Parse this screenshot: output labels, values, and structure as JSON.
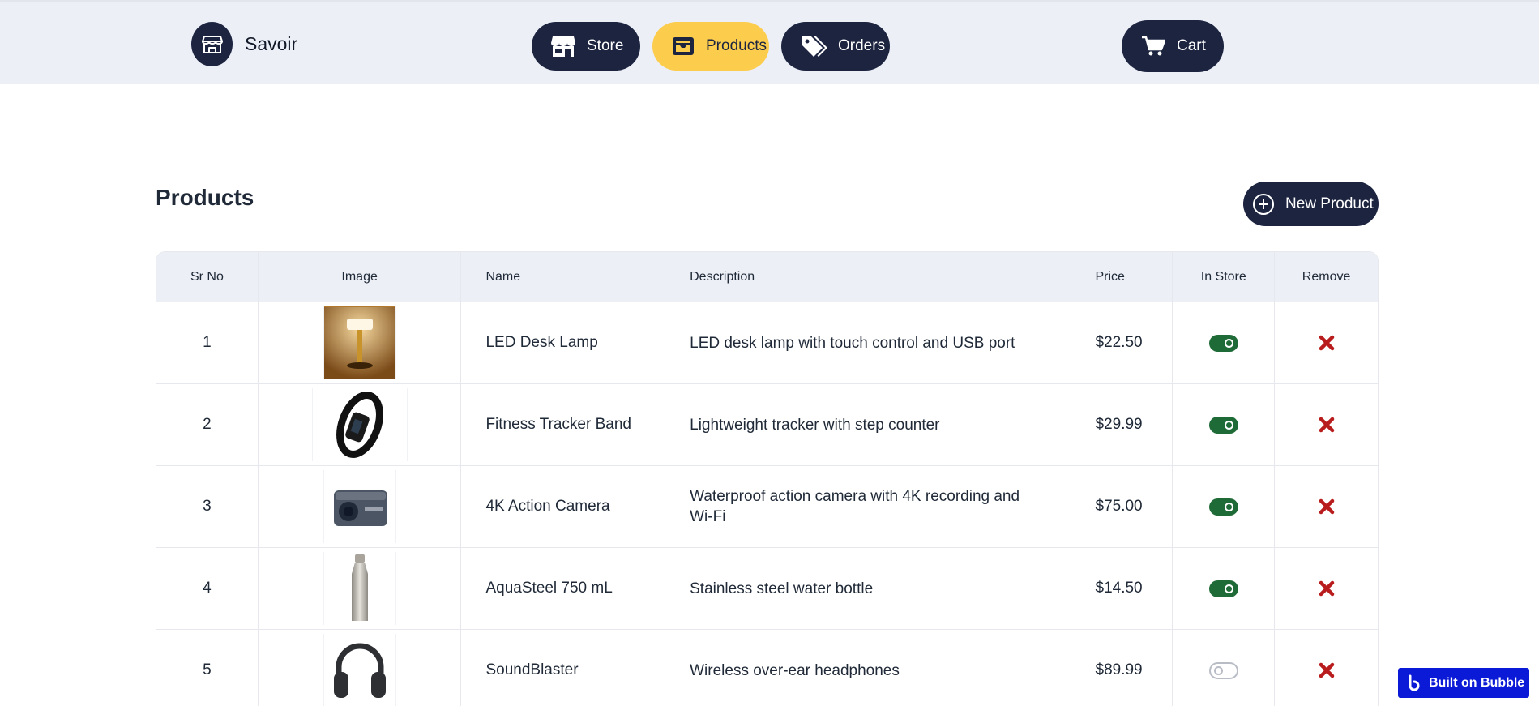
{
  "header": {
    "brand_name": "Savoir",
    "nav": {
      "store_label": "Store",
      "products_label": "Products",
      "orders_label": "Orders",
      "cart_label": "Cart"
    },
    "active_nav": "Products"
  },
  "page": {
    "title": "Products",
    "new_product_label": "New Product"
  },
  "table": {
    "headers": {
      "sr_no": "Sr No",
      "image": "Image",
      "name": "Name",
      "description": "Description",
      "price": "Price",
      "in_store": "In Store",
      "remove": "Remove"
    },
    "rows": [
      {
        "sr": "1",
        "image_icon": "desk-lamp-image",
        "name": "LED Desk Lamp",
        "description": "LED desk lamp with touch control and USB port",
        "price": "$22.50",
        "in_store": true
      },
      {
        "sr": "2",
        "image_icon": "fitness-band-image",
        "name": "Fitness Tracker Band",
        "description": "Lightweight tracker with step counter",
        "price": "$29.99",
        "in_store": true
      },
      {
        "sr": "3",
        "image_icon": "action-camera-image",
        "name": "4K Action Camera",
        "description": "Waterproof action camera with 4K recording and Wi-Fi",
        "price": "$75.00",
        "in_store": true
      },
      {
        "sr": "4",
        "image_icon": "water-bottle-image",
        "name": "AquaSteel 750 mL",
        "description": "Stainless steel water bottle",
        "price": "$14.50",
        "in_store": true
      },
      {
        "sr": "5",
        "image_icon": "headphones-image",
        "name": "SoundBlaster",
        "description": "Wireless over-ear headphones",
        "price": "$89.99",
        "in_store": false
      }
    ]
  },
  "badge": {
    "label": "Built on Bubble"
  },
  "colors": {
    "navy": "#1c2440",
    "active_yellow": "#fccc4d",
    "header_bg": "#eceff6",
    "toggle_on": "#1f6b37",
    "remove_red": "#b91c1c",
    "bubble_blue": "#0b1ad6"
  }
}
